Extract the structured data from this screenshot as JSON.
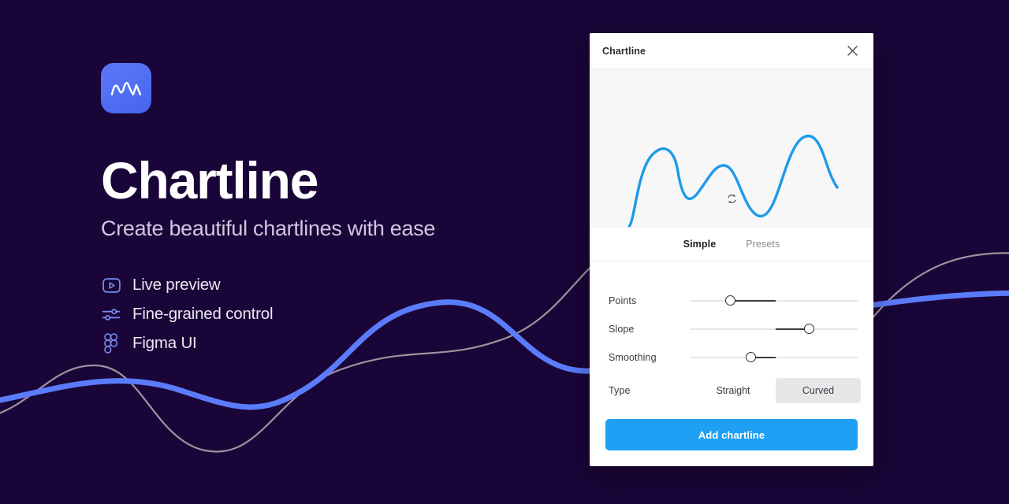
{
  "theme": {
    "background": "#1a0538",
    "brand_blue": "#4f6ef2",
    "accent_blue": "#1ea0f5",
    "curve_blue": "#5b7cfa",
    "curve_beige": "#bdb2b6"
  },
  "hero": {
    "logo_icon": "chartline-logo-icon",
    "title": "Chartline",
    "subtitle": "Create beautiful chartlines with ease",
    "features": [
      {
        "icon": "play-box-icon",
        "label": "Live preview"
      },
      {
        "icon": "sliders-icon",
        "label": "Fine-grained control"
      },
      {
        "icon": "figma-icon",
        "label": "Figma UI"
      }
    ]
  },
  "panel": {
    "title": "Chartline",
    "close_icon": "close-icon",
    "preview": {
      "refresh_icon": "refresh-icon",
      "curve_color": "#1e9ae8"
    },
    "tabs": [
      {
        "label": "Simple",
        "active": true
      },
      {
        "label": "Presets",
        "active": false
      }
    ],
    "sliders": [
      {
        "label": "Points",
        "thumb_pct": 24,
        "fill_from_pct": 24,
        "fill_to_pct": 51
      },
      {
        "label": "Slope",
        "thumb_pct": 71,
        "fill_from_pct": 51,
        "fill_to_pct": 71
      },
      {
        "label": "Smoothing",
        "thumb_pct": 36,
        "fill_from_pct": 36,
        "fill_to_pct": 51
      }
    ],
    "type": {
      "label": "Type",
      "options": [
        {
          "label": "Straight",
          "selected": false
        },
        {
          "label": "Curved",
          "selected": true
        }
      ]
    },
    "submit_label": "Add chartline"
  },
  "chart_data": {
    "type": "line",
    "title": "",
    "xlabel": "",
    "ylabel": "",
    "legend": [],
    "grid": false,
    "series": [
      {
        "name": "preview-chartline",
        "color": "#1e9ae8",
        "x": [
          0,
          8,
          20,
          33,
          45,
          57,
          70,
          82,
          92,
          100
        ],
        "y": [
          14,
          8,
          60,
          47,
          58,
          30,
          28,
          82,
          95,
          70
        ]
      }
    ],
    "xlim": [
      0,
      100
    ],
    "ylim": [
      0,
      100
    ]
  },
  "background_curves": [
    {
      "name": "blue-wave",
      "color": "#5b7cfa",
      "width": 7
    },
    {
      "name": "beige-wave",
      "color": "#bdb2b6",
      "width": 2.2
    }
  ]
}
